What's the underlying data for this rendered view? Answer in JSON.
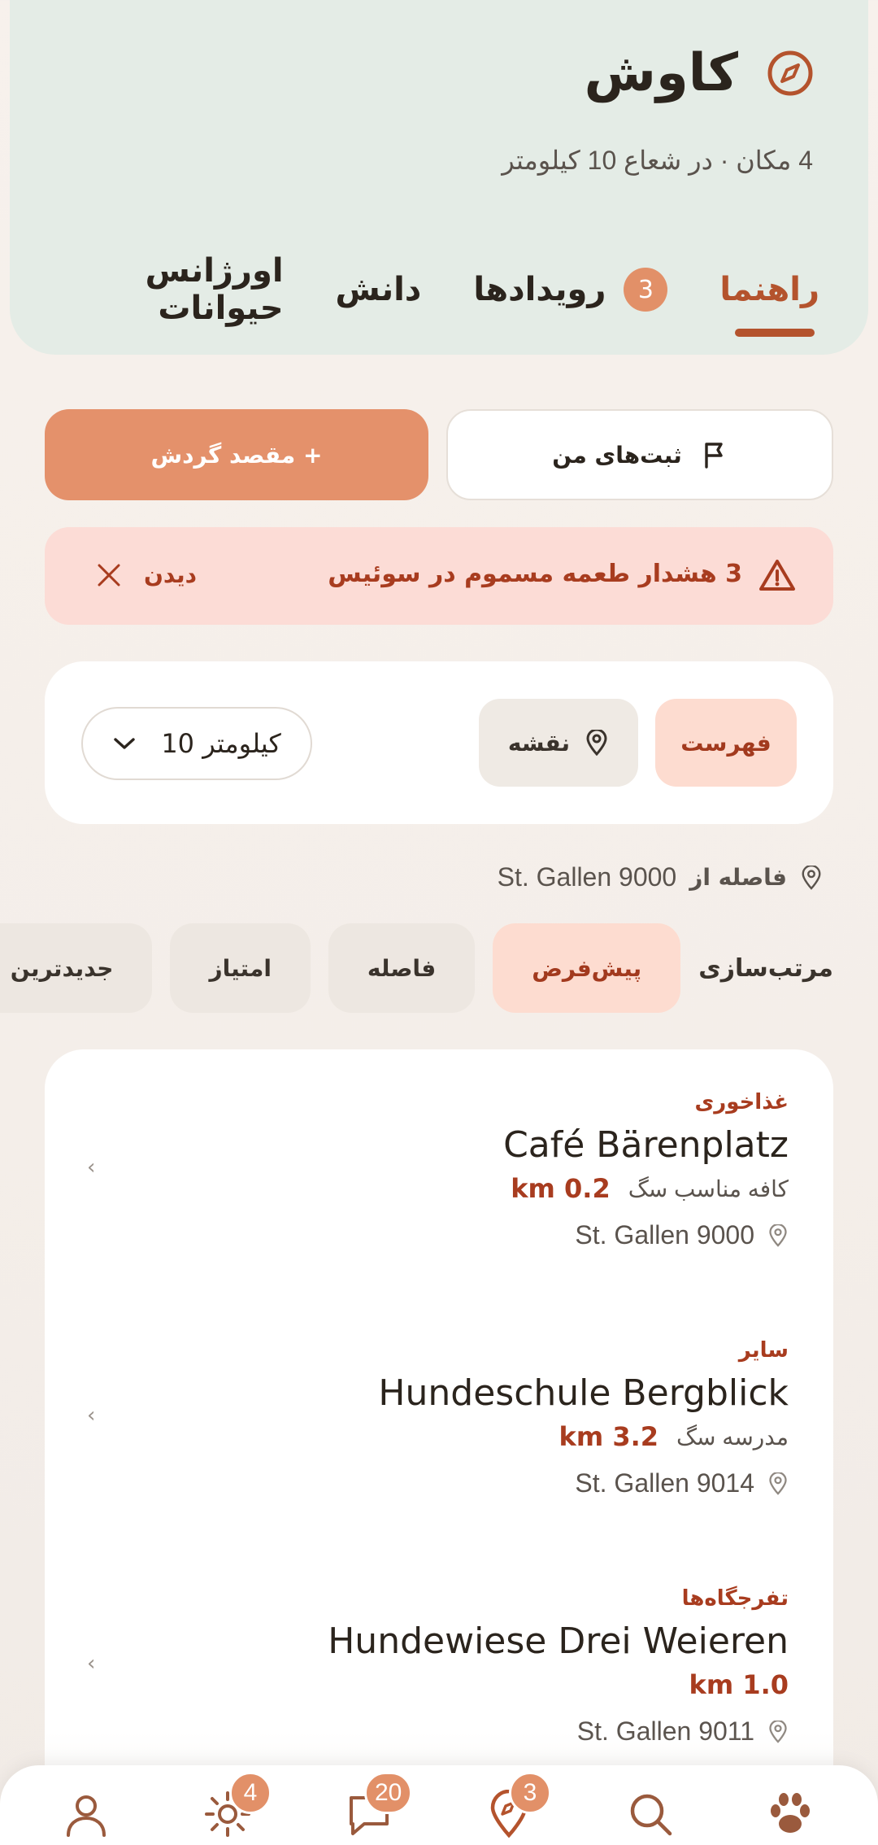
{
  "header": {
    "title": "کاوش",
    "subtitle": "4 مکان · در شعاع 10 کیلومتر",
    "icon": "compass-icon",
    "tabs": [
      {
        "label": "راهنما",
        "active": true
      },
      {
        "label": "رویدادها",
        "badge": "3"
      },
      {
        "label": "دانش"
      },
      {
        "label": "اورژانس حیوانات"
      }
    ]
  },
  "actions": {
    "my_entries": "ثبت‌های من",
    "add_destination": "+ مقصد گردش"
  },
  "alert": {
    "text": "3 هشدار طعمه مسموم در سوئیس",
    "view": "دیدن",
    "color": "#a83c1f"
  },
  "filters": {
    "list_label": "فهرست",
    "map_label": "نقشه",
    "radius_value": "10 کیلومتر"
  },
  "distance_from": {
    "label": "فاصله از",
    "location": "St. Gallen 9000"
  },
  "sort": {
    "label": "مرتب‌سازی",
    "options": [
      {
        "label": "پیش‌فرض",
        "active": true
      },
      {
        "label": "فاصله"
      },
      {
        "label": "امتیاز"
      },
      {
        "label": "جدیدترین"
      }
    ]
  },
  "places": [
    {
      "category": "غذاخوری",
      "name": "Café Bärenplatz",
      "tag": "کافه مناسب سگ",
      "distance": "0.2 km",
      "address": "St. Gallen 9000"
    },
    {
      "category": "سایر",
      "name": "Hundeschule Bergblick",
      "tag": "مدرسه سگ",
      "distance": "3.2 km",
      "address": "St. Gallen 9014"
    },
    {
      "category": "تفرجگاه‌ها",
      "name": "Hundewiese Drei Weieren",
      "tag": "",
      "distance": "1.0 km",
      "address": "St. Gallen 9011"
    }
  ],
  "nav": {
    "items": [
      {
        "icon": "paw-icon"
      },
      {
        "icon": "search-icon"
      },
      {
        "icon": "map-pin-icon",
        "badge": "3"
      },
      {
        "icon": "chat-icon",
        "badge": "20"
      },
      {
        "icon": "sun-icon",
        "badge": "4"
      },
      {
        "icon": "profile-icon"
      }
    ]
  },
  "colors": {
    "accent": "#b4532d",
    "primary_button": "#e4916b",
    "header_bg": "#e4ece6",
    "alert_bg": "#fcdcd6"
  }
}
